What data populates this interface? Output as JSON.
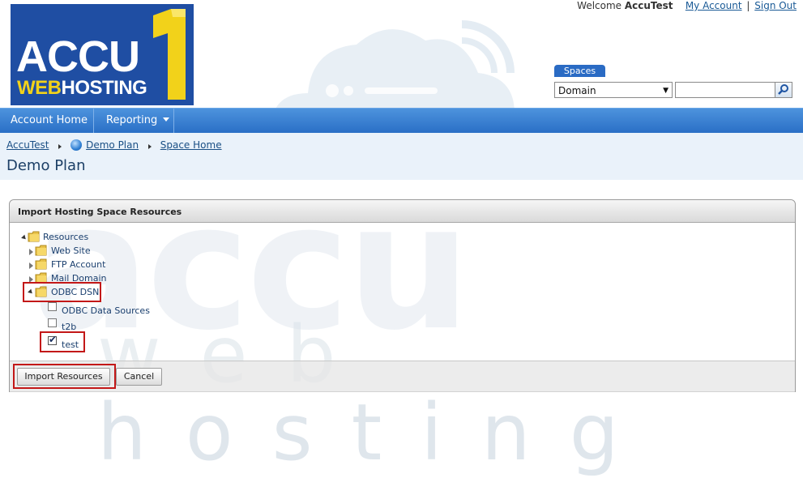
{
  "header": {
    "logo_text_accu": "ACCU",
    "logo_text_web": "WEB",
    "logo_text_hosting": "HOSTING",
    "welcome_prefix": "Welcome",
    "user_name": "AccuTest",
    "my_account_link": "My Account",
    "separator": "|",
    "sign_out_link": "Sign Out",
    "spaces_tab": "Spaces",
    "domain_select_value": "Domain",
    "search_value": "",
    "logo_bg_color": "#1f4ea3",
    "logo_accent_color": "#f2d21a"
  },
  "nav": {
    "items": [
      {
        "label": "Account Home"
      },
      {
        "label": "Reporting"
      }
    ],
    "bar_color": "#3a80d2"
  },
  "breadcrumb": {
    "items": [
      {
        "label": "AccuTest"
      },
      {
        "label": "Demo Plan"
      },
      {
        "label": "Space Home"
      }
    ]
  },
  "page": {
    "title": "Demo Plan"
  },
  "panel": {
    "title": "Import Hosting Space Resources",
    "tree": {
      "root": "Resources",
      "children": [
        {
          "label": "Web Site",
          "expanded": false
        },
        {
          "label": "FTP Account",
          "expanded": false
        },
        {
          "label": "Mail Domain",
          "expanded": false
        },
        {
          "label": "ODBC DSN",
          "expanded": true,
          "children": [
            {
              "label": "ODBC Data Sources",
              "checked": false
            },
            {
              "label": "t2b",
              "checked": false
            },
            {
              "label": "test",
              "checked": true
            }
          ]
        }
      ]
    },
    "buttons": {
      "import": "Import Resources",
      "cancel": "Cancel"
    },
    "highlight_color": "#c31818"
  },
  "watermark": {
    "big_text": "accu",
    "small_text": "web hosting"
  }
}
